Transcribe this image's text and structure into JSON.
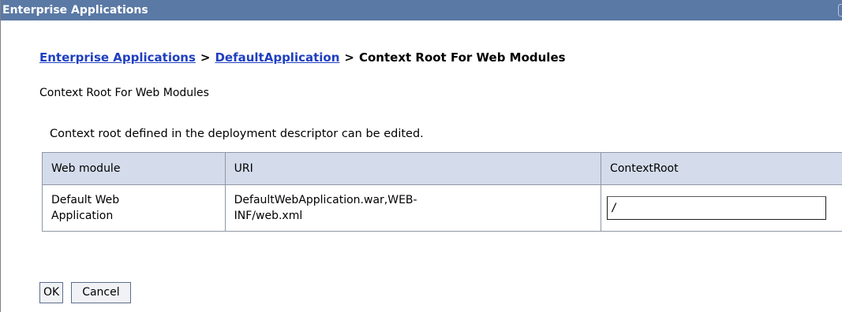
{
  "window": {
    "title": "Enterprise Applications"
  },
  "breadcrumb": {
    "link1": "Enterprise Applications",
    "separator1": ">",
    "link2": "DefaultApplication",
    "separator2": ">",
    "current": "Context Root For Web Modules"
  },
  "page": {
    "heading": "Context Root For Web Modules",
    "table_caption": "Context root defined in the deployment descriptor can be edited."
  },
  "table": {
    "headers": {
      "web_module": "Web module",
      "uri": "URI",
      "context_root": "ContextRoot"
    },
    "rows": [
      {
        "web_module_line1": "Default Web",
        "web_module_line2": "Application",
        "uri_line1": "DefaultWebApplication.war,WEB-",
        "uri_line2": "INF/web.xml",
        "context_root_value": "/"
      }
    ]
  },
  "buttons": {
    "ok_label": "OK",
    "cancel_label": "Cancel"
  },
  "colors": {
    "titlebar_bg": "#5a79a5",
    "link": "#1f3fbf",
    "header_bg": "#d4dcec",
    "border": "#8f97a4"
  }
}
